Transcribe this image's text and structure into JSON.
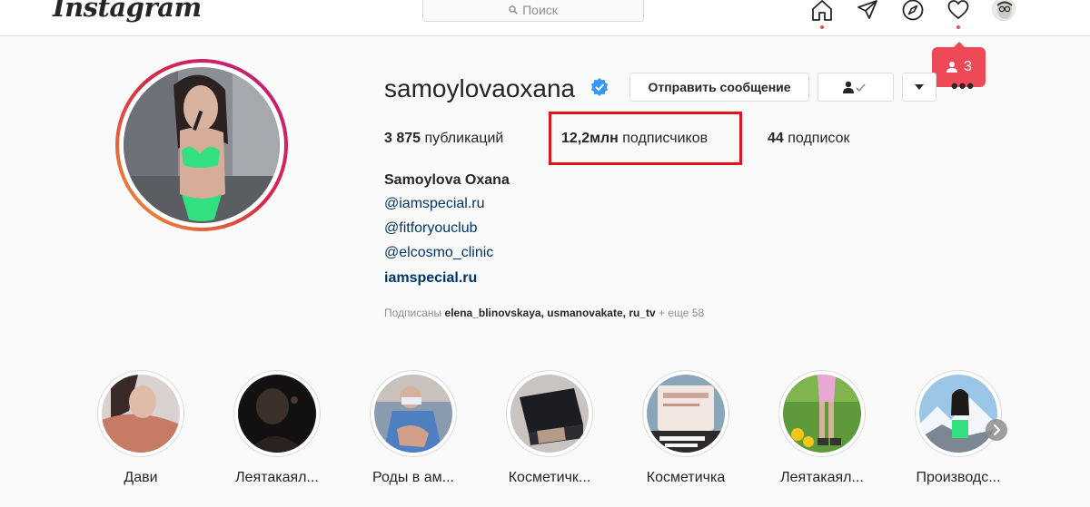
{
  "header": {
    "logo": "Instagram",
    "search_placeholder": "Поиск",
    "nav_icons": [
      "home-icon",
      "direct-icon",
      "explore-icon",
      "activity-icon",
      "profile-avatar"
    ],
    "notification_count": "3"
  },
  "profile": {
    "username": "samoylovaoxana",
    "verified": true,
    "message_button": "Отправить сообщение",
    "more_label": "•••",
    "stats": {
      "posts_count": "3 875",
      "posts_label": "публикаций",
      "followers_count": "12,2млн",
      "followers_label": "подписчиков",
      "following_count": "44",
      "following_label": "подписок"
    },
    "full_name": "Samoylova Oxana",
    "bio_links": [
      "@iamspecial.ru",
      "@fitforyouclub",
      "@elcosmo_clinic"
    ],
    "website": "iamspecial.ru",
    "followed_by": {
      "prefix": "Подписаны",
      "accounts": [
        "elena_blinovskaya",
        "usmanovakate",
        "ru_tv"
      ],
      "more": "+ еще 58"
    }
  },
  "stories": [
    {
      "label": "Дави"
    },
    {
      "label": "Леятакаял..."
    },
    {
      "label": "Роды в ам..."
    },
    {
      "label": "Косметичк..."
    },
    {
      "label": "Косметичка"
    },
    {
      "label": "Леятакаял..."
    },
    {
      "label": "Производс..."
    }
  ],
  "colors": {
    "accent_red": "#ed4956",
    "link_blue": "#003569",
    "verified_blue": "#3897f0",
    "highlight_box": "#e0141e"
  }
}
